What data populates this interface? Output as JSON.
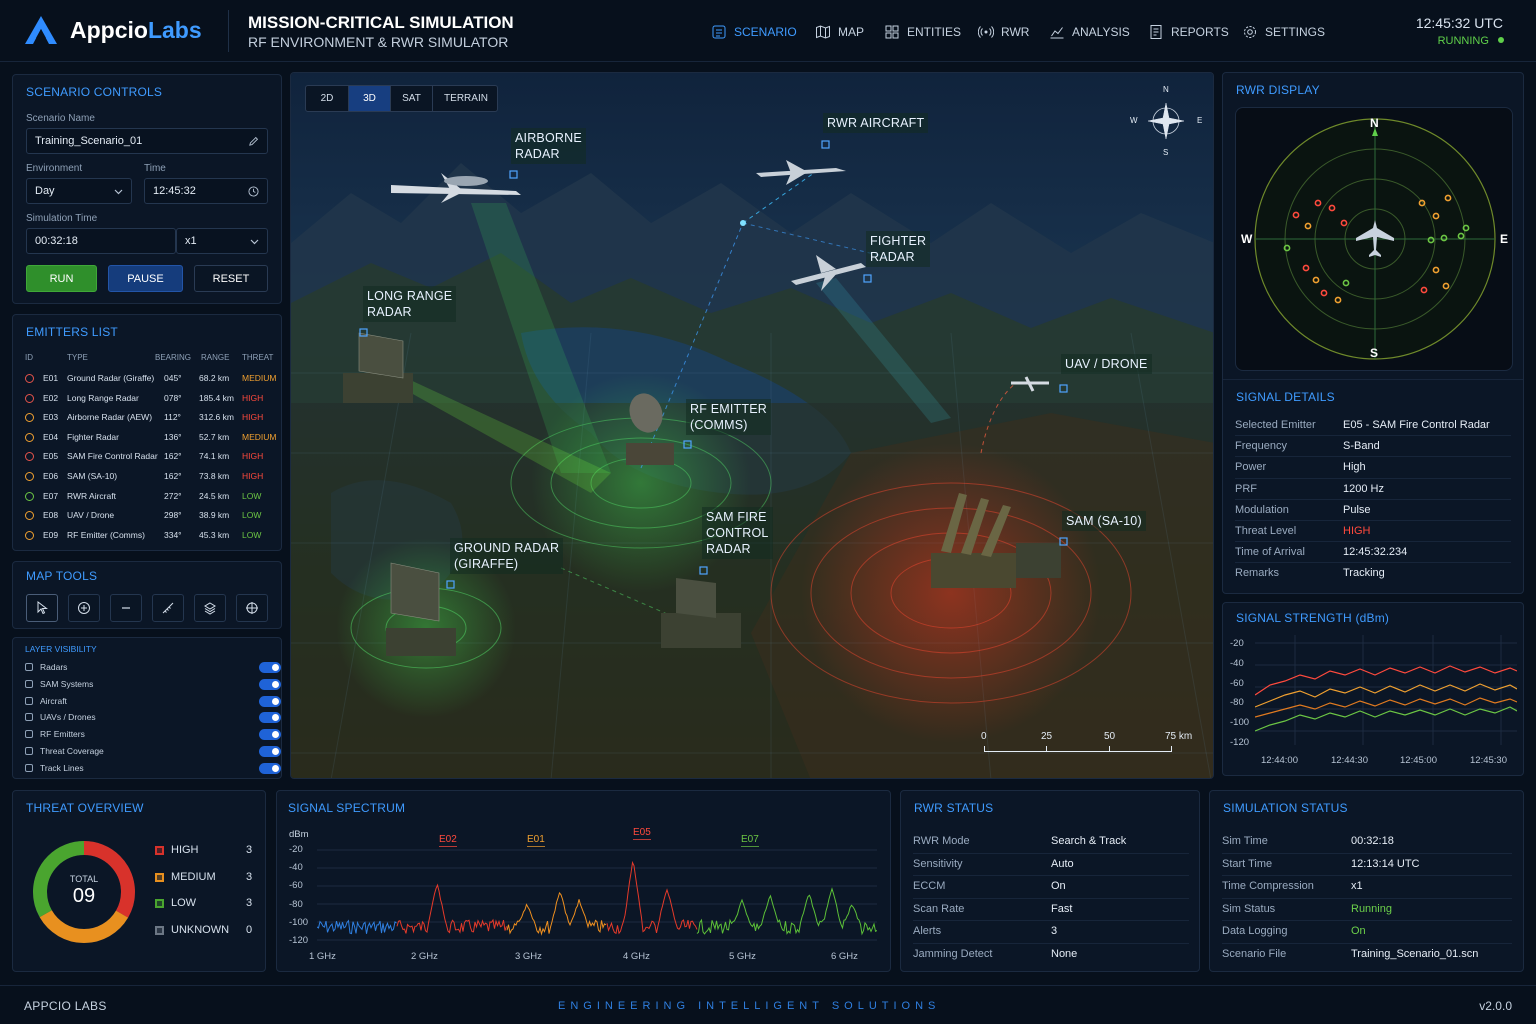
{
  "brand": {
    "name_a": "Appcio",
    "name_b": "Labs"
  },
  "header": {
    "title": "MISSION-CRITICAL SIMULATION",
    "subtitle": "RF ENVIRONMENT & RWR SIMULATOR",
    "clock": "12:45:32 UTC",
    "status": "RUNNING"
  },
  "nav": [
    {
      "label": "SCENARIO",
      "active": true,
      "icon": "scenario-icon"
    },
    {
      "label": "MAP",
      "icon": "map-icon"
    },
    {
      "label": "ENTITIES",
      "icon": "entities-icon"
    },
    {
      "label": "RWR",
      "icon": "rwr-icon"
    },
    {
      "label": "ANALYSIS",
      "icon": "analysis-icon"
    },
    {
      "label": "REPORTS",
      "icon": "reports-icon"
    },
    {
      "label": "SETTINGS",
      "icon": "gear-icon"
    }
  ],
  "scenario": {
    "title": "SCENARIO CONTROLS",
    "name_label": "Scenario Name",
    "name_value": "Training_Scenario_01",
    "env_label": "Environment",
    "env_value": "Day",
    "time_label": "Time",
    "time_value": "12:45:32",
    "simtime_label": "Simulation Time",
    "simtime_value": "00:32:18",
    "speed_value": "x1",
    "run": "RUN",
    "pause": "PAUSE",
    "reset": "RESET"
  },
  "emitters": {
    "title": "EMITTERS LIST",
    "headers": [
      "ID",
      "TYPE",
      "BEARING",
      "RANGE",
      "THREAT"
    ],
    "rows": [
      {
        "id": "E01",
        "type": "Ground Radar (Giraffe)",
        "bearing": "045°",
        "range": "68.2 km",
        "threat": "MEDIUM",
        "color": "#e5534b"
      },
      {
        "id": "E02",
        "type": "Long Range Radar",
        "bearing": "078°",
        "range": "185.4 km",
        "threat": "HIGH",
        "color": "#e5534b"
      },
      {
        "id": "E03",
        "type": "Airborne Radar (AEW)",
        "bearing": "112°",
        "range": "312.6 km",
        "threat": "HIGH",
        "color": "#f0a030"
      },
      {
        "id": "E04",
        "type": "Fighter Radar",
        "bearing": "136°",
        "range": "52.7 km",
        "threat": "MEDIUM",
        "color": "#f0a030"
      },
      {
        "id": "E05",
        "type": "SAM Fire Control Radar",
        "bearing": "162°",
        "range": "74.1 km",
        "threat": "HIGH",
        "color": "#e5534b"
      },
      {
        "id": "E06",
        "type": "SAM (SA-10)",
        "bearing": "162°",
        "range": "73.8 km",
        "threat": "HIGH",
        "color": "#f0a030"
      },
      {
        "id": "E07",
        "type": "RWR Aircraft",
        "bearing": "272°",
        "range": "24.5 km",
        "threat": "LOW",
        "color": "#6cc644"
      },
      {
        "id": "E08",
        "type": "UAV / Drone",
        "bearing": "298°",
        "range": "38.9 km",
        "threat": "LOW",
        "color": "#f0a030"
      },
      {
        "id": "E09",
        "type": "RF Emitter (Comms)",
        "bearing": "334°",
        "range": "45.3 km",
        "threat": "LOW",
        "color": "#f0a030"
      }
    ],
    "threat_colors": {
      "HIGH": "#ff4a3d",
      "MEDIUM": "#f0a030",
      "LOW": "#6cc644"
    }
  },
  "map_tools": {
    "title": "MAP TOOLS",
    "tools": [
      "pointer-icon",
      "zoom-in-icon",
      "zoom-out-icon",
      "ruler-icon",
      "layers-icon",
      "crosshair-icon"
    ]
  },
  "layers": {
    "title": "LAYER VISIBILITY",
    "items": [
      "Radars",
      "SAM Systems",
      "Aircraft",
      "UAVs / Drones",
      "RF Emitters",
      "Threat Coverage",
      "Track Lines"
    ]
  },
  "map": {
    "view_tabs": [
      "2D",
      "3D",
      "SAT",
      "TERRAIN"
    ],
    "active_view": "3D",
    "labels": {
      "airborne": [
        "AIRBORNE",
        "RADAR"
      ],
      "rwr_aircraft": [
        "RWR AIRCRAFT"
      ],
      "fighter": [
        "FIGHTER",
        "RADAR"
      ],
      "long_range": [
        "LONG RANGE",
        "RADAR"
      ],
      "uav": [
        "UAV / DRONE"
      ],
      "rf_emitter": [
        "RF EMITTER",
        "(COMMS)"
      ],
      "sam_fc": [
        "SAM FIRE",
        "CONTROL",
        "RADAR"
      ],
      "sam": [
        "SAM (SA-10)"
      ],
      "ground": [
        "GROUND RADAR",
        "(GIRAFFE)"
      ]
    },
    "compass": {
      "n": "N",
      "s": "S",
      "e": "E",
      "w": "W"
    },
    "scale": [
      "0",
      "25",
      "50",
      "75 km"
    ]
  },
  "rwr": {
    "title": "RWR DISPLAY",
    "n": "N",
    "s": "S",
    "e": "E",
    "w": "W"
  },
  "signal_details": {
    "title": "SIGNAL DETAILS",
    "rows": [
      {
        "k": "Selected Emitter",
        "v": "E05 - SAM Fire Control Radar"
      },
      {
        "k": "Frequency",
        "v": "S-Band"
      },
      {
        "k": "Power",
        "v": "High"
      },
      {
        "k": "PRF",
        "v": "1200 Hz"
      },
      {
        "k": "Modulation",
        "v": "Pulse"
      },
      {
        "k": "Threat Level",
        "v": "HIGH",
        "color": "#ff4a3d"
      },
      {
        "k": "Time of Arrival",
        "v": "12:45:32.234"
      },
      {
        "k": "Remarks",
        "v": "Tracking"
      }
    ]
  },
  "signal_strength": {
    "title": "SIGNAL STRENGTH (dBm)",
    "y_ticks": [
      "-20",
      "-40",
      "-60",
      "-80",
      "-100",
      "-120"
    ],
    "x_ticks": [
      "12:44:00",
      "12:44:30",
      "12:45:00",
      "12:45:30"
    ]
  },
  "threat_overview": {
    "title": "THREAT OVERVIEW",
    "total_label": "TOTAL",
    "total": "09",
    "items": [
      {
        "label": "HIGH",
        "count": "3",
        "color": "#d8322b"
      },
      {
        "label": "MEDIUM",
        "count": "3",
        "color": "#e8901f"
      },
      {
        "label": "LOW",
        "count": "3",
        "color": "#4aa52f"
      },
      {
        "label": "UNKNOWN",
        "count": "0",
        "color": "#6c7785"
      }
    ]
  },
  "spectrum": {
    "title": "SIGNAL SPECTRUM",
    "unit": "dBm",
    "y_ticks": [
      "-20",
      "-40",
      "-60",
      "-80",
      "-100",
      "-120"
    ],
    "x_ticks": [
      "1 GHz",
      "2 GHz",
      "3 GHz",
      "4 GHz",
      "5 GHz",
      "6 GHz"
    ],
    "peaks": [
      {
        "label": "E02",
        "color": "#ff4a3d"
      },
      {
        "label": "E01",
        "color": "#f0a030"
      },
      {
        "label": "E05",
        "color": "#ff4a3d"
      },
      {
        "label": "E07",
        "color": "#6cc644"
      }
    ]
  },
  "rwr_status": {
    "title": "RWR STATUS",
    "rows": [
      {
        "k": "RWR Mode",
        "v": "Search & Track"
      },
      {
        "k": "Sensitivity",
        "v": "Auto"
      },
      {
        "k": "ECCM",
        "v": "On"
      },
      {
        "k": "Scan Rate",
        "v": "Fast"
      },
      {
        "k": "Alerts",
        "v": "3"
      },
      {
        "k": "Jamming Detect",
        "v": "None"
      }
    ]
  },
  "sim_status": {
    "title": "SIMULATION STATUS",
    "rows": [
      {
        "k": "Sim Time",
        "v": "00:32:18"
      },
      {
        "k": "Start Time",
        "v": "12:13:14 UTC"
      },
      {
        "k": "Time Compression",
        "v": "x1"
      },
      {
        "k": "Sim Status",
        "v": "Running",
        "color": "#6cd04a"
      },
      {
        "k": "Data Logging",
        "v": "On",
        "color": "#6cd04a"
      },
      {
        "k": "Scenario File",
        "v": "Training_Scenario_01.scn"
      }
    ]
  },
  "footer": {
    "left": "APPCIO LABS",
    "center": "ENGINEERING INTELLIGENT SOLUTIONS",
    "right": "v2.0.0"
  }
}
